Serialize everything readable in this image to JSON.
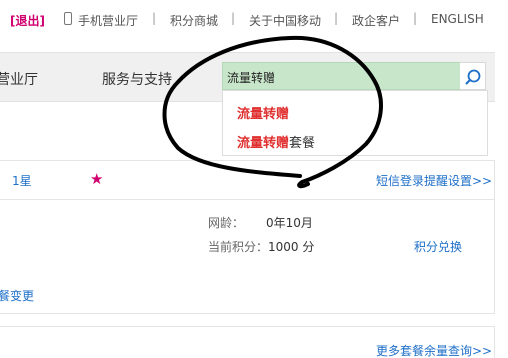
{
  "topbar": {
    "logout": "[退出]",
    "mobile_hall": "手机营业厅",
    "points_mall": "积分商城",
    "about": "关于中国移动",
    "enterprise": "政企客户",
    "english": "ENGLISH",
    "separator": "|"
  },
  "navbar": {
    "hall_partial": "营业厅",
    "service": "服务与支持"
  },
  "search": {
    "value": "流量转赠",
    "icon": "search-icon",
    "suggestions": [
      {
        "highlight": "流量转赠",
        "rest": ""
      },
      {
        "highlight": "流量转赠",
        "rest": "套餐"
      }
    ]
  },
  "account": {
    "star_level": "1星",
    "sms_login_reminder": "短信登录提醒设置>>",
    "net_age_label": "网龄：",
    "net_age_value": "0年10月",
    "points_label": "当前积分：",
    "points_value": "1000 分",
    "redeem_points": "积分兑换",
    "package_change_partial": "餐变更",
    "more_package_query": "更多套餐余量查询>>"
  },
  "colors": {
    "logout": "#d0006f",
    "link": "#1e6fc8",
    "search_bg": "#c8e6c9",
    "highlight": "#e03030",
    "star": "#d0006f"
  }
}
